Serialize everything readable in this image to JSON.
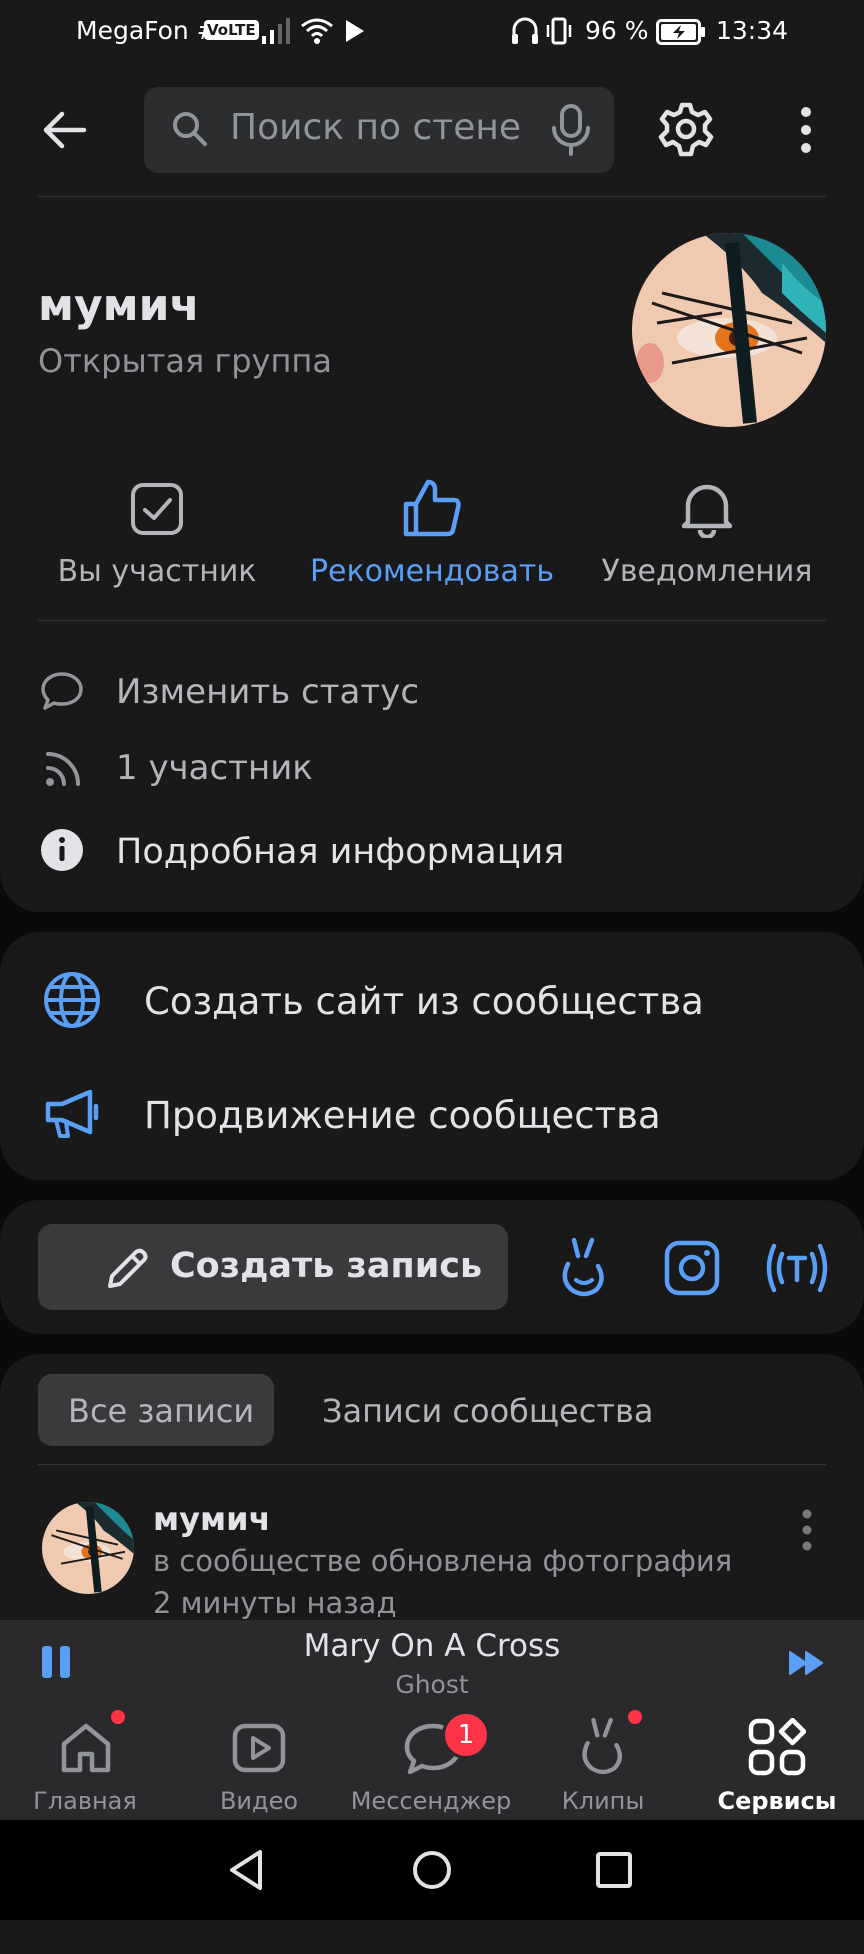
{
  "status_bar": {
    "carrier": "MegaFon #1",
    "volte": "VoLTE",
    "battery": "96 %",
    "time": "13:34"
  },
  "header": {
    "search_placeholder": "Поиск по стене",
    "icons": [
      "back-arrow-icon",
      "search-icon",
      "microphone-icon",
      "gear-icon",
      "more-vertical-icon"
    ]
  },
  "profile": {
    "name": "мумич",
    "type": "Открытая группа"
  },
  "actions": [
    {
      "label": "Вы участник",
      "icon": "checkbox-icon",
      "color": "#b2b5b9"
    },
    {
      "label": "Рекомендовать",
      "icon": "thumbs-up-icon",
      "color": "#5a9ef6"
    },
    {
      "label": "Уведомления",
      "icon": "bell-icon",
      "color": "#b2b5b9"
    }
  ],
  "info": {
    "status": "Изменить статус",
    "members": "1 участник",
    "details": "Подробная информация"
  },
  "services": {
    "create_site": "Создать сайт из сообщества",
    "promotion": "Продвижение сообщества"
  },
  "composer": {
    "create_post": "Создать запись"
  },
  "feed": {
    "tabs": [
      "Все записи",
      "Записи сообщества"
    ],
    "post": {
      "author": "мумич",
      "text": "в сообществе обновлена фотография",
      "time": "2 минуты назад"
    }
  },
  "player": {
    "title": "Mary On A Cross",
    "artist": "Ghost"
  },
  "tabbar": {
    "items": [
      "Главная",
      "Видео",
      "Мессенджер",
      "Клипы",
      "Сервисы"
    ],
    "messenger_badge": "1"
  },
  "colors": {
    "accent": "#5a9ef6",
    "background": "#19191a",
    "badge": "#ff3347"
  }
}
